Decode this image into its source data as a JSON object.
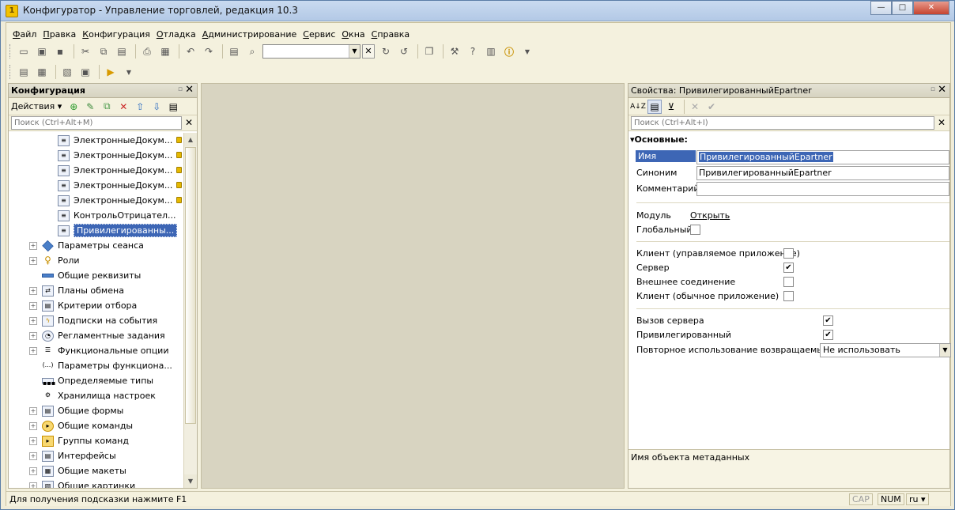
{
  "window": {
    "title": "Конфигуратор - Управление торговлей, редакция 10.3"
  },
  "menu": [
    "Файл",
    "Правка",
    "Конфигурация",
    "Отладка",
    "Администрирование",
    "Сервис",
    "Окна",
    "Справка"
  ],
  "left_panel": {
    "title": "Конфигурация",
    "actions_label": "Действия ▾",
    "search_placeholder": "Поиск (Ctrl+Alt+M)",
    "tree": [
      {
        "label": "ЭлектронныеДокум...",
        "level": 2,
        "lock": true
      },
      {
        "label": "ЭлектронныеДокум...",
        "level": 2,
        "lock": true
      },
      {
        "label": "ЭлектронныеДокум...",
        "level": 2,
        "lock": true
      },
      {
        "label": "ЭлектронныеДокум...",
        "level": 2,
        "lock": true
      },
      {
        "label": "ЭлектронныеДокум...",
        "level": 2,
        "lock": true
      },
      {
        "label": "КонтрольОтрицател...",
        "level": 2,
        "lock": false
      },
      {
        "label": "Привилегированны...",
        "level": 2,
        "lock": false,
        "selected": true
      },
      {
        "label": "Параметры сеанса",
        "level": 1,
        "expandable": true
      },
      {
        "label": "Роли",
        "level": 1,
        "expandable": true
      },
      {
        "label": "Общие реквизиты",
        "level": 1,
        "expandable": false
      },
      {
        "label": "Планы обмена",
        "level": 1,
        "expandable": true
      },
      {
        "label": "Критерии отбора",
        "level": 1,
        "expandable": true
      },
      {
        "label": "Подписки на события",
        "level": 1,
        "expandable": true
      },
      {
        "label": "Регламентные задания",
        "level": 1,
        "expandable": true
      },
      {
        "label": "Функциональные опции",
        "level": 1,
        "expandable": true
      },
      {
        "label": "Параметры функциона...",
        "level": 1,
        "expandable": false
      },
      {
        "label": "Определяемые типы",
        "level": 1,
        "expandable": false
      },
      {
        "label": "Хранилища настроек",
        "level": 1,
        "expandable": false
      },
      {
        "label": "Общие формы",
        "level": 1,
        "expandable": true
      },
      {
        "label": "Общие команды",
        "level": 1,
        "expandable": true
      },
      {
        "label": "Группы команд",
        "level": 1,
        "expandable": true
      },
      {
        "label": "Интерфейсы",
        "level": 1,
        "expandable": true
      },
      {
        "label": "Общие макеты",
        "level": 1,
        "expandable": true
      },
      {
        "label": "Общие картинки",
        "level": 1,
        "expandable": true
      }
    ]
  },
  "right_panel": {
    "title": "Свойства: ПривилегированныйEpartner",
    "search_placeholder": "Поиск (Ctrl+Alt+I)",
    "group": "Основные:",
    "name_label": "Имя",
    "name_value": "ПривилегированныйEpartner",
    "synonym_label": "Синоним",
    "synonym_value": "ПривилегированныйEpartner",
    "comment_label": "Комментарий",
    "comment_value": "",
    "module_label": "Модуль",
    "module_link": "Открыть",
    "global_label": "Глобальный",
    "client_managed_label": "Клиент (управляемое приложение)",
    "server_label": "Сервер",
    "external_label": "Внешнее соединение",
    "client_ordinary_label": "Клиент (обычное приложение)",
    "server_call_label": "Вызов сервера",
    "privileged_label": "Привилегированный",
    "reuse_label": "Повторное использование возвращаемых зн",
    "reuse_value": "Не использовать",
    "description": "Имя объекта метаданных",
    "checks": {
      "global": false,
      "client_managed": false,
      "server": true,
      "external": false,
      "client_ordinary": false,
      "server_call": true,
      "privileged": true
    }
  },
  "status": {
    "hint": "Для получения подсказки нажмите F1",
    "cap": "CAP",
    "num": "NUM",
    "lang": "ru ▾"
  },
  "icons": {
    "check": "✔",
    "close": "✕"
  }
}
